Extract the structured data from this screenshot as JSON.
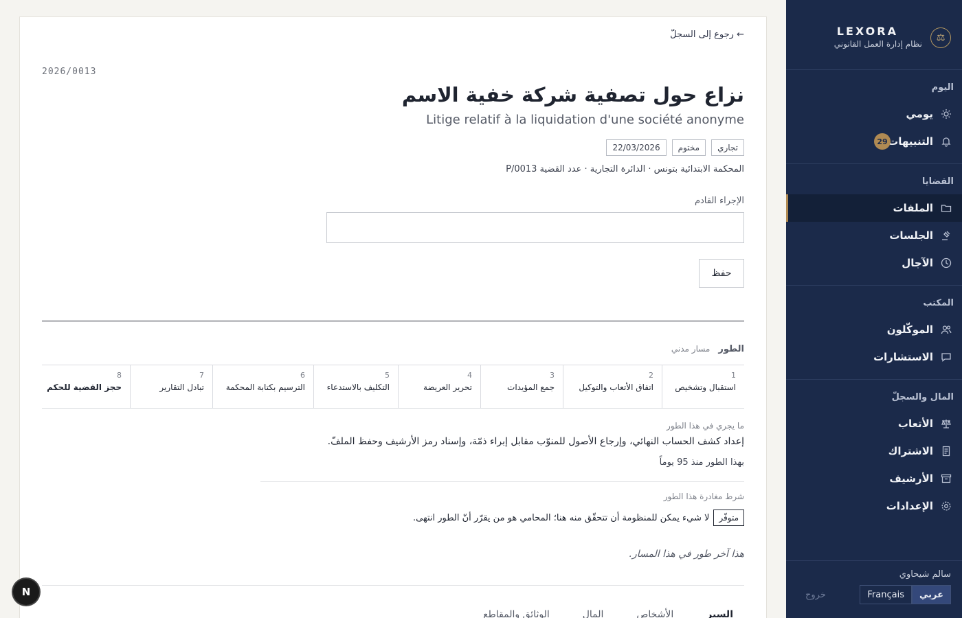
{
  "brand": {
    "name": "LEXORA",
    "subtitle": "نظام إدارة العمل القانوني"
  },
  "sidebar": {
    "sections": [
      {
        "heading": "اليوم",
        "items": [
          {
            "label": "يومي",
            "icon": "sun-icon"
          },
          {
            "label": "التنبيهات",
            "icon": "bell-icon",
            "badge": "29"
          }
        ]
      },
      {
        "heading": "القضايا",
        "items": [
          {
            "label": "الملفات",
            "icon": "folder-icon",
            "active": true
          },
          {
            "label": "الجلسات",
            "icon": "gavel-icon"
          },
          {
            "label": "الآجال",
            "icon": "clock-icon"
          }
        ]
      },
      {
        "heading": "المكتب",
        "items": [
          {
            "label": "الموكّلون",
            "icon": "users-icon"
          },
          {
            "label": "الاستشارات",
            "icon": "chat-icon"
          }
        ]
      },
      {
        "heading": "المال والسجلّ",
        "items": [
          {
            "label": "الأتعاب",
            "icon": "scale-icon"
          },
          {
            "label": "الاشتراك",
            "icon": "document-icon"
          },
          {
            "label": "الأرشيف",
            "icon": "archive-icon"
          },
          {
            "label": "الإعدادات",
            "icon": "gear-icon"
          }
        ]
      }
    ],
    "user_name": "سالم شيحاوي",
    "lang_ar": "عربي",
    "lang_fr": "Français",
    "logout": "خروج"
  },
  "case": {
    "back": "← رجوع إلى السجلّ",
    "number": "2026/0013",
    "title_ar": "نزاع حول تصفية شركة خفية الاسم",
    "title_fr": "Litige relatif à la liquidation d'une société anonyme",
    "tags": [
      "تجاري",
      "مختوم",
      "22/03/2026"
    ],
    "court": "المحكمة الابتدائية بتونس · الدائرة التجارية · عدد القضية 0013/P",
    "next_label": "الإجراء القادم",
    "next_value": "",
    "save": "حفظ"
  },
  "stage": {
    "heading": "الطور",
    "track": "مسار مدني",
    "steps": [
      {
        "n": "1",
        "label": "استقبال وتشخيص"
      },
      {
        "n": "2",
        "label": "اتفاق الأتعاب والتوكيل"
      },
      {
        "n": "3",
        "label": "جمع المؤيدات"
      },
      {
        "n": "4",
        "label": "تحرير العريضة"
      },
      {
        "n": "5",
        "label": "التكليف بالاستدعاء"
      },
      {
        "n": "6",
        "label": "الترسيم بكتابة المحكمة"
      },
      {
        "n": "7",
        "label": "تبادل التقارير"
      },
      {
        "n": "8",
        "label": "حجز القضية للحكم"
      }
    ],
    "what_label": "ما يجري في هذا الطور",
    "what_text": "إعداد كشف الحساب النهائي، وإرجاع الأصول للمنوّب مقابل إبراء ذمّة، وإسناد رمز الأرشيف وحفظ الملفّ.",
    "since": "بهذا الطور منذ 95 يوماً",
    "exit_label": "شرط مغادرة هذا الطور",
    "exit_badge": "متوفّر",
    "exit_text": "لا شيء يمكن للمنظومة أن تتحقّق منه هنا؛ المحامي هو من يقرّر أنّ الطور انتهى.",
    "last": "هذا آخر طور في هذا المسار."
  },
  "tabs": [
    "السير",
    "الأشخاص",
    "المال",
    "الوثائق والمقاطع"
  ],
  "next_badge": "N"
}
